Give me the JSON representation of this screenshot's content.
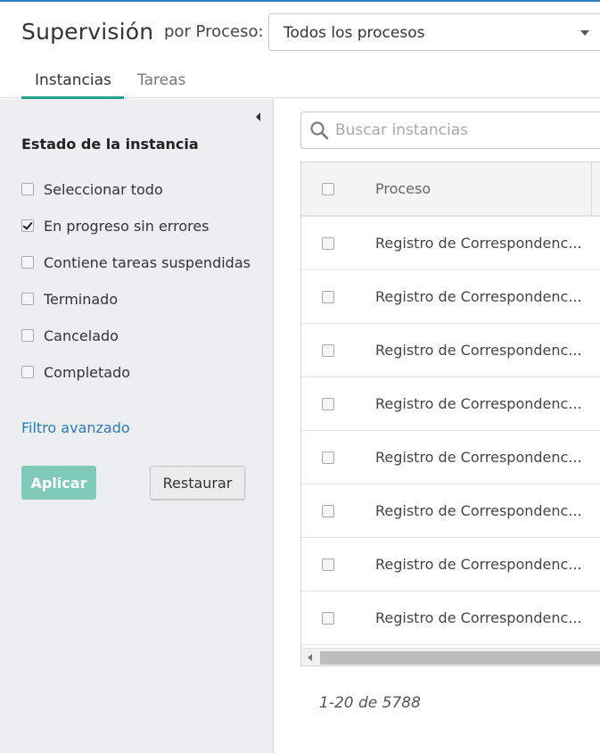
{
  "header": {
    "title": "Supervisión",
    "process_label": "por Proceso:",
    "process_value": "Todos los procesos",
    "tabs": [
      {
        "label": "Instancias",
        "active": true
      },
      {
        "label": "Tareas",
        "active": false
      }
    ]
  },
  "sidebar": {
    "section_title": "Estado de la instancia",
    "filters": [
      {
        "label": "Seleccionar todo",
        "checked": false
      },
      {
        "label": "En progreso sin errores",
        "checked": true
      },
      {
        "label": "Contiene tareas suspendidas",
        "checked": false
      },
      {
        "label": "Terminado",
        "checked": false
      },
      {
        "label": "Cancelado",
        "checked": false
      },
      {
        "label": "Completado",
        "checked": false
      }
    ],
    "advanced_filter": "Filtro avanzado",
    "apply_label": "Aplicar",
    "reset_label": "Restaurar"
  },
  "main": {
    "search_placeholder": "Buscar instancias",
    "table": {
      "columns": [
        "Proceso"
      ],
      "rows": [
        "Registro de Correspondenc...",
        "Registro de Correspondenc...",
        "Registro de Correspondenc...",
        "Registro de Correspondenc...",
        "Registro de Correspondenc...",
        "Registro de Correspondenc...",
        "Registro de Correspondenc...",
        "Registro de Correspondenc..."
      ]
    },
    "pager": "1-20 de 5788"
  },
  "colors": {
    "accent": "#26a08a",
    "link": "#2a7bbf",
    "apply_button": "#7fcab8",
    "sidebar_bg": "#eceeef"
  }
}
